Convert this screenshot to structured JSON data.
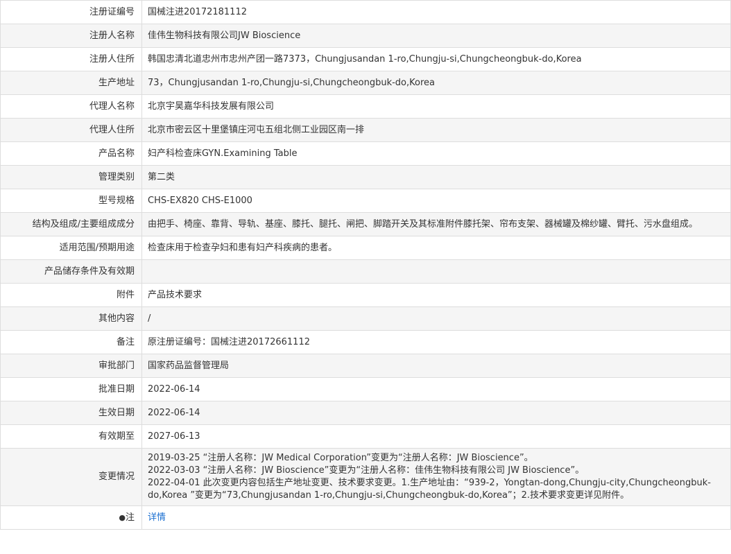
{
  "rows": [
    {
      "label": "注册证编号",
      "value": "国械注进20172181112"
    },
    {
      "label": "注册人名称",
      "value": "佳伟生物科技有限公司JW Bioscience"
    },
    {
      "label": "注册人住所",
      "value": "韩国忠清北道忠州市忠州产团一路7373，Chungjusandan 1-ro,Chungju-si,Chungcheongbuk-do,Korea"
    },
    {
      "label": "生产地址",
      "value": "73，Chungjusandan 1-ro,Chungju-si,Chungcheongbuk-do,Korea"
    },
    {
      "label": "代理人名称",
      "value": "北京宇昊嘉华科技发展有限公司"
    },
    {
      "label": "代理人住所",
      "value": "北京市密云区十里堡镇庄河屯五组北侧工业园区南一排"
    },
    {
      "label": "产品名称",
      "value": "妇产科检查床GYN.Examining Table"
    },
    {
      "label": "管理类别",
      "value": "第二类"
    },
    {
      "label": "型号规格",
      "value": "CHS-EX820 CHS-E1000"
    },
    {
      "label": "结构及组成/主要组成成分",
      "value": "由把手、椅座、靠背、导轨、基座、膝托、腿托、闸把、脚踏开关及其标准附件膝托架、帘布支架、器械罐及棉纱罐、臂托、污水盘组成。"
    },
    {
      "label": "适用范围/预期用途",
      "value": "检查床用于检查孕妇和患有妇产科疾病的患者。"
    },
    {
      "label": "产品储存条件及有效期",
      "value": ""
    },
    {
      "label": "附件",
      "value": "产品技术要求"
    },
    {
      "label": "其他内容",
      "value": "/"
    },
    {
      "label": "备注",
      "value": "原注册证编号：国械注进20172661112"
    },
    {
      "label": "审批部门",
      "value": "国家药品监督管理局"
    },
    {
      "label": "批准日期",
      "value": "2022-06-14"
    },
    {
      "label": "生效日期",
      "value": "2022-06-14"
    },
    {
      "label": "有效期至",
      "value": "2027-06-13"
    }
  ],
  "change": {
    "label": "变更情况",
    "lines": [
      "2019-03-25 “注册人名称：JW Medical Corporation”变更为“注册人名称：JW Bioscience”。",
      "2022-03-03 “注册人名称：JW Bioscience”变更为“注册人名称：佳伟生物科技有限公司 JW Bioscience”。",
      "2022-04-01 此次变更内容包括生产地址变更、技术要求变更。1.生产地址由：“939-2，Yongtan-dong,Chungju-city,Chungcheongbuk-do,Korea ”变更为“73,Chungjusandan 1-ro,Chungju-si,Chungcheongbuk-do,Korea”；2.技术要求变更详见附件。"
    ]
  },
  "note": {
    "icon": "●",
    "label": "注",
    "link": "详情"
  }
}
